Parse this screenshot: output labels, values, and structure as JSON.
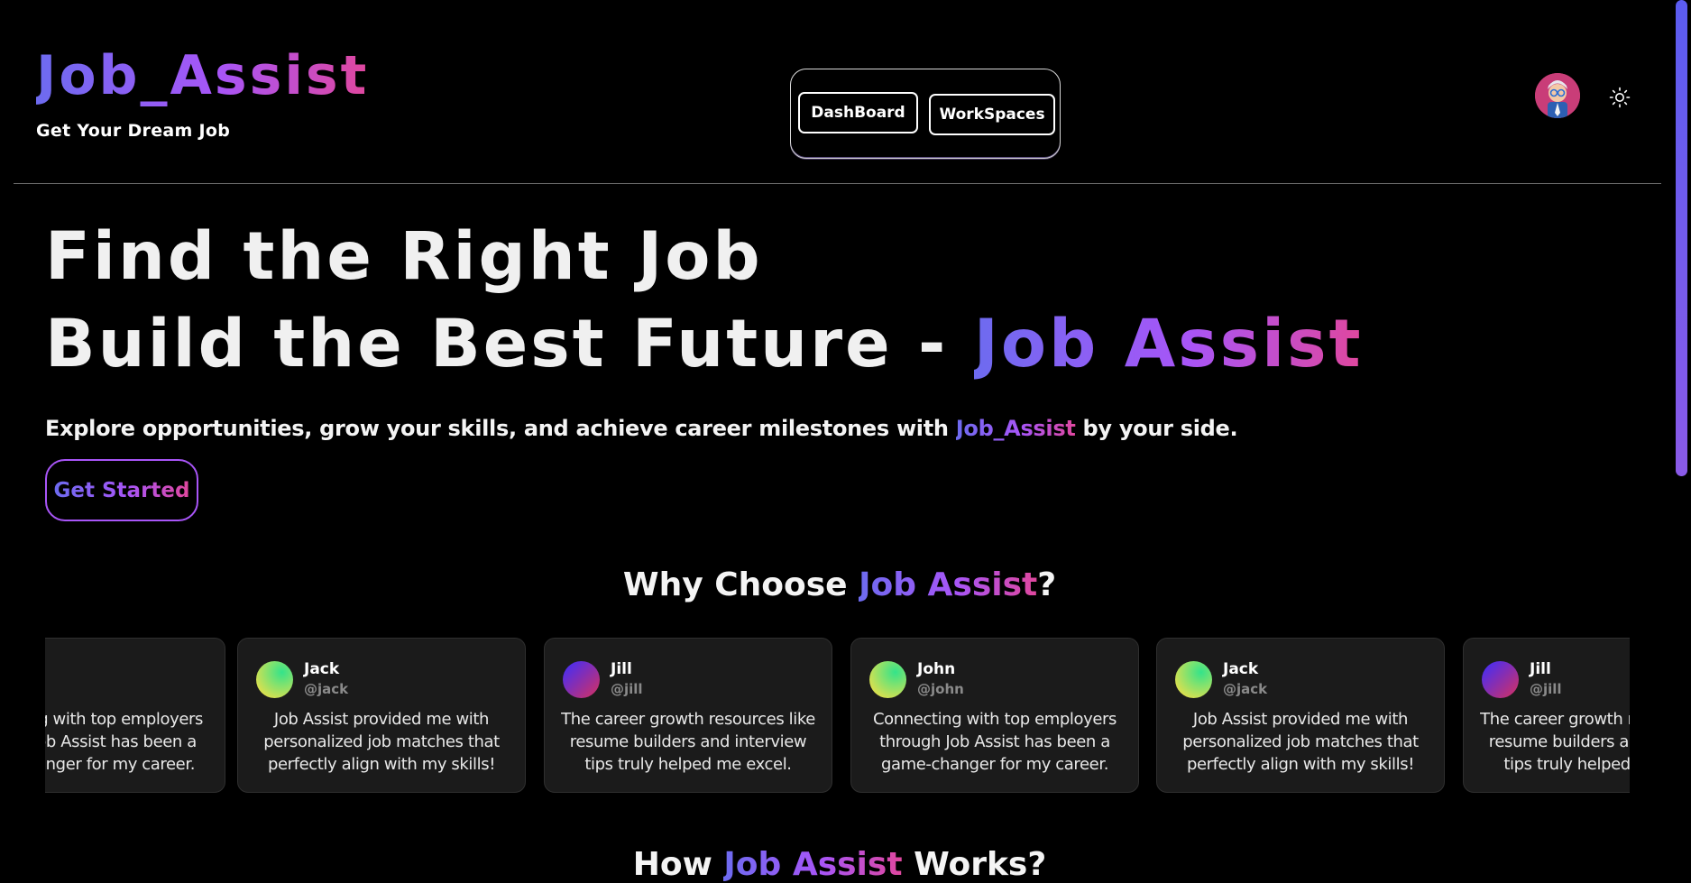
{
  "brand": {
    "title": "Job_Assist",
    "tagline": "Get Your Dream Job"
  },
  "nav": {
    "dashboard": "DashBoard",
    "workspaces": "WorkSpaces"
  },
  "hero": {
    "line1": "Find the Right Job",
    "line2_prefix": "Build the Best Future - ",
    "line2_highlight": "Job Assist",
    "subtitle_prefix": "Explore opportunities, grow your skills, and achieve career milestones with ",
    "subtitle_highlight": "Job_Assist",
    "subtitle_suffix": " by your side.",
    "cta": "Get Started"
  },
  "why": {
    "prefix": "Why Choose ",
    "highlight": "Job Assist",
    "suffix": "?"
  },
  "testimonials": [
    {
      "name": "",
      "handle": "",
      "quote": "Connecting with top employers through Job Assist has been a game-changer for my career.",
      "avatar": "green-gradient"
    },
    {
      "name": "Jack",
      "handle": "@jack",
      "quote": "Job Assist provided me with personalized job matches that perfectly align with my skills!",
      "avatar": "green-gradient"
    },
    {
      "name": "Jill",
      "handle": "@jill",
      "quote": "The career growth resources like resume builders and interview tips truly helped me excel.",
      "avatar": "purple-gradient"
    },
    {
      "name": "John",
      "handle": "@john",
      "quote": "Connecting with top employers through Job Assist has been a game-changer for my career.",
      "avatar": "green-gradient"
    },
    {
      "name": "Jack",
      "handle": "@jack",
      "quote": "Job Assist provided me with personalized job matches that perfectly align with my skills!",
      "avatar": "green-gradient"
    },
    {
      "name": "Jill",
      "handle": "@jill",
      "quote": "The career growth resources like resume builders and interview tips truly helped me excel.",
      "avatar": "purple-gradient"
    }
  ],
  "how": {
    "prefix": "How ",
    "highlight": "Job Assist",
    "suffix": " Works?"
  },
  "icons": {
    "theme_toggle": "sun-icon",
    "profile": "avatar"
  },
  "colors": {
    "accent_start": "#6d6bf0",
    "accent_mid": "#a855f7",
    "accent_end": "#e0479e",
    "background": "#000000"
  }
}
